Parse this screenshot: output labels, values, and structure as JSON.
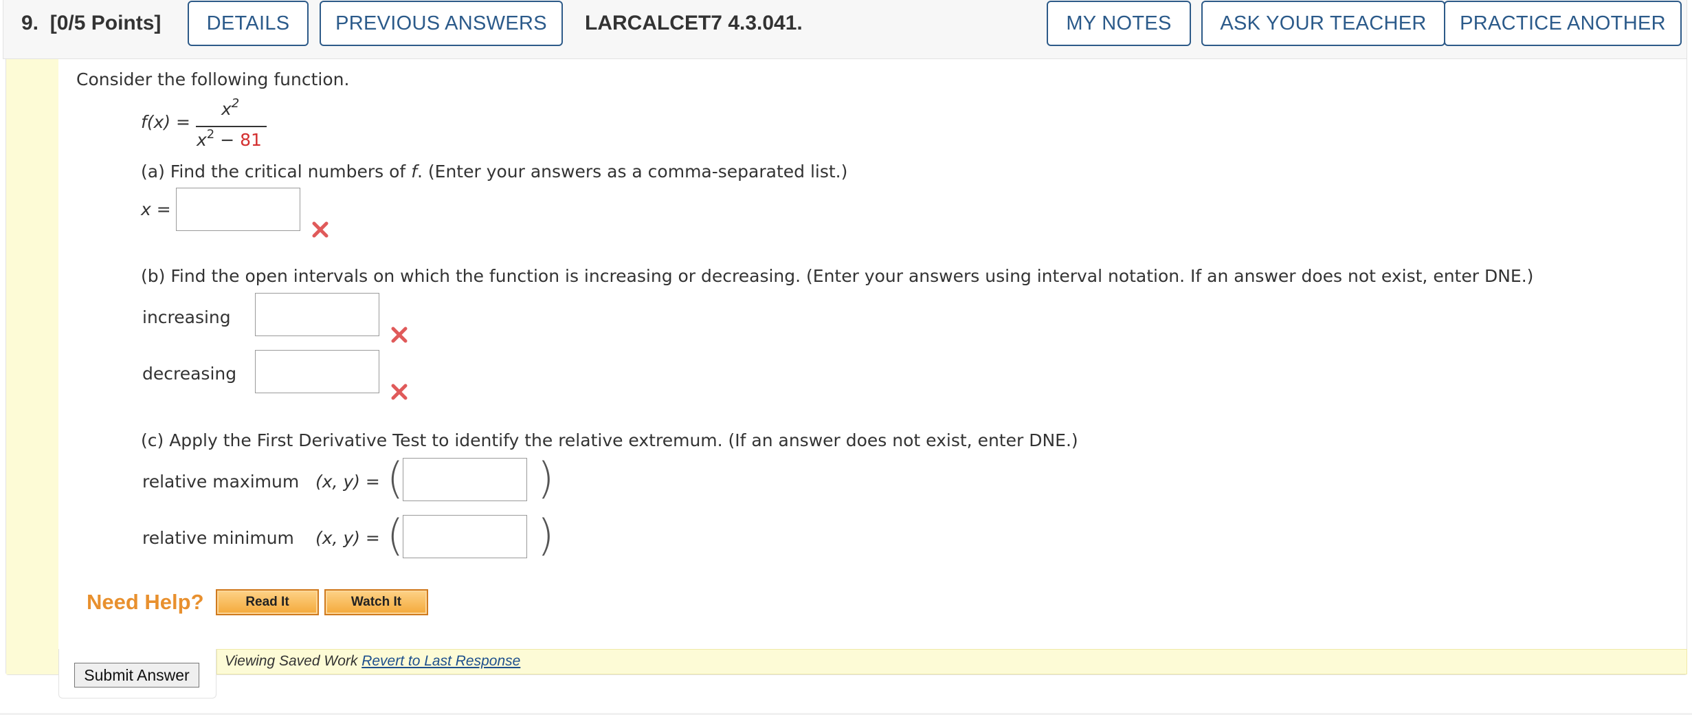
{
  "header": {
    "question_number": "9.",
    "points": "[0/5 Points]",
    "details_label": "DETAILS",
    "previous_answers_label": "PREVIOUS ANSWERS",
    "question_code": "LARCALCET7 4.3.041.",
    "my_notes_label": "MY NOTES",
    "ask_teacher_label": "ASK YOUR TEACHER",
    "practice_another_label": "PRACTICE ANOTHER"
  },
  "question": {
    "intro": "Consider the following function.",
    "function_lhs": "f(x) =",
    "numerator": "x",
    "numerator_exp": "2",
    "denominator_var": "x",
    "denominator_exp": "2",
    "denominator_minus": " − ",
    "denominator_const": "81",
    "part_a": {
      "prompt_prefix": "(a) Find the critical numbers of ",
      "prompt_f": "f",
      "prompt_suffix": ". (Enter your answers as a comma-separated list.)",
      "var_label": "x =",
      "answer_value": "",
      "status": "incorrect"
    },
    "part_b": {
      "prompt": "(b) Find the open intervals on which the function is increasing or decreasing. (Enter your answers using interval notation. If an answer does not exist, enter DNE.)",
      "increasing_label": "increasing",
      "increasing_value": "",
      "increasing_status": "incorrect",
      "decreasing_label": "decreasing",
      "decreasing_value": "",
      "decreasing_status": "incorrect"
    },
    "part_c": {
      "prompt": "(c) Apply the First Derivative Test to identify the relative extremum. (If an answer does not exist, enter DNE.)",
      "max_label": "relative maximum",
      "min_label": "relative minimum",
      "pair_label": "(x, y) =",
      "max_value": "",
      "min_value": ""
    }
  },
  "help": {
    "need_help_label": "Need Help?",
    "read_it_label": "Read It",
    "watch_it_label": "Watch It"
  },
  "footer": {
    "submit_label": "Submit Answer",
    "saved_text": "Viewing Saved Work ",
    "revert_link": "Revert to Last Response"
  },
  "colors": {
    "accent_blue": "#2b5a8a",
    "incorrect_red": "#e05a5a",
    "help_orange": "#e8902e",
    "saved_bar": "#fdfbd6"
  },
  "icons": {
    "incorrect_mark": "x-mark-icon"
  }
}
